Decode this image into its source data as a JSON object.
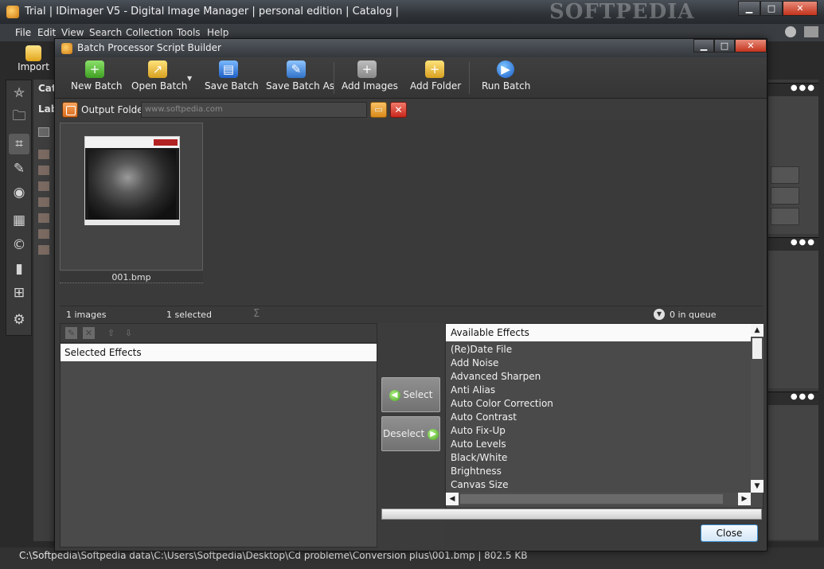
{
  "main_window": {
    "title": "Trial | IDimager V5 - Digital Image Manager | personal edition | Catalog |",
    "watermark": "SOFTPEDIA",
    "controls": {
      "minimize": "▁",
      "maximize": "□",
      "close": "✕"
    }
  },
  "main_menu": [
    "File",
    "Edit",
    "View",
    "Search",
    "Collection",
    "Tools",
    "Help"
  ],
  "import_label": "Import",
  "left_rail_icons": [
    "pentagram-icon",
    "folder-icon",
    "tag-icon",
    "pencil-icon",
    "eye-icon",
    "grid-icon",
    "copyright-icon",
    "chart-icon",
    "hierarchy-icon",
    "gear-icon"
  ],
  "bg_panel_labels": {
    "cat": "Cat",
    "lab": "Lab"
  },
  "status_bar": "C:\\Softpedia\\Softpedia data\\C:\\Users\\Softpedia\\Desktop\\Cd probleme\\Conversion plus\\001.bmp  |  802.5 KB",
  "dialog": {
    "title": "Batch Processor Script Builder",
    "controls": {
      "minimize": "▁",
      "maximize": "□",
      "close": "✕"
    },
    "toolbar": {
      "new_batch": "New Batch",
      "open_batch": "Open Batch",
      "save_batch": "Save Batch",
      "save_batch_as": "Save Batch As",
      "add_images": "Add Images",
      "add_folder": "Add Folder",
      "run_batch": "Run Batch"
    },
    "output_folder": {
      "label": "Output Folder",
      "value": "www.softpedia.com"
    },
    "thumbnail": {
      "filename": "001.bmp"
    },
    "statusbar": {
      "images": "1 images",
      "selected": "1 selected",
      "sigma": "Σ",
      "queue": "0 in queue"
    },
    "selected_effects_header": "Selected Effects",
    "select_label": "Select",
    "deselect_label": "Deselect",
    "available_effects_header": "Available Effects",
    "available_effects": [
      "(Re)Date File",
      "Add Noise",
      "Advanced Sharpen",
      "Anti Alias",
      "Auto Color Correction",
      "Auto Contrast",
      "Auto Fix-Up",
      "Auto Levels",
      "Black/White",
      "Brightness",
      "Canvas Size"
    ],
    "close_label": "Close"
  },
  "colors": {
    "accent_blue": "#3c8fd2",
    "dialog_bg": "#3b3b3b",
    "header_bg": "#fafafa"
  }
}
